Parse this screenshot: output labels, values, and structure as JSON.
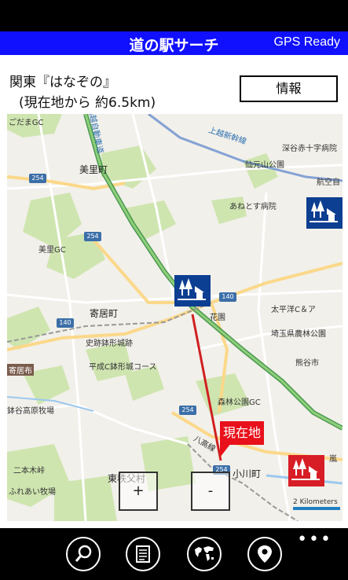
{
  "header": {
    "title": "道の駅サーチ",
    "gps_status": "GPS Ready"
  },
  "station": {
    "name": "関東『はなぞの』",
    "distance": "(現在地から 約6.5km)",
    "info_label": "情報"
  },
  "map": {
    "current_location_label": "現在地",
    "labels": {
      "gc1": "ごだまGC",
      "misato": "美里町",
      "yorii": "寄居町",
      "ryokuen": "花園",
      "ogawa": "小川町",
      "shinrin": "森林公園GC",
      "higashi_chichibu": "東秩父村",
      "kanetsu": "関越自動車道",
      "joetsu": "上越新幹線",
      "fukaya": "深谷赤十字病院",
      "senkanyama": "仙元山公園",
      "aneto": "あねとす病院",
      "misato_gc": "美里GC",
      "taiheiyo": "太平洋C＆ア",
      "hanazono_kaiyuu": "埼玉県農林公園",
      "shiseki": "史跡鉢形城跡",
      "heisei": "平成C鉢形城コース",
      "kounosu": "熊谷市",
      "ikoi": "寄居布",
      "kosai": "鉢谷高原牧場",
      "futatsu": "二本木峠",
      "takazawa": "ふれあい牧場",
      "hachiko": "八高線",
      "kokubun": "航空自",
      "tanaka": "嵐"
    },
    "route_numbers": [
      "254",
      "254",
      "140",
      "140",
      "254",
      "254"
    ],
    "zoom_in": "+",
    "zoom_out": "-",
    "scale": "2 Kilometers"
  },
  "appbar": {
    "more": "•••",
    "icons": [
      "search-icon",
      "list-icon",
      "globe-icon",
      "location-pin-icon"
    ]
  },
  "colors": {
    "header": "#1010ff",
    "station_blue": "#0c3e91",
    "station_red": "#d71d26",
    "route_line": "#d02020"
  }
}
